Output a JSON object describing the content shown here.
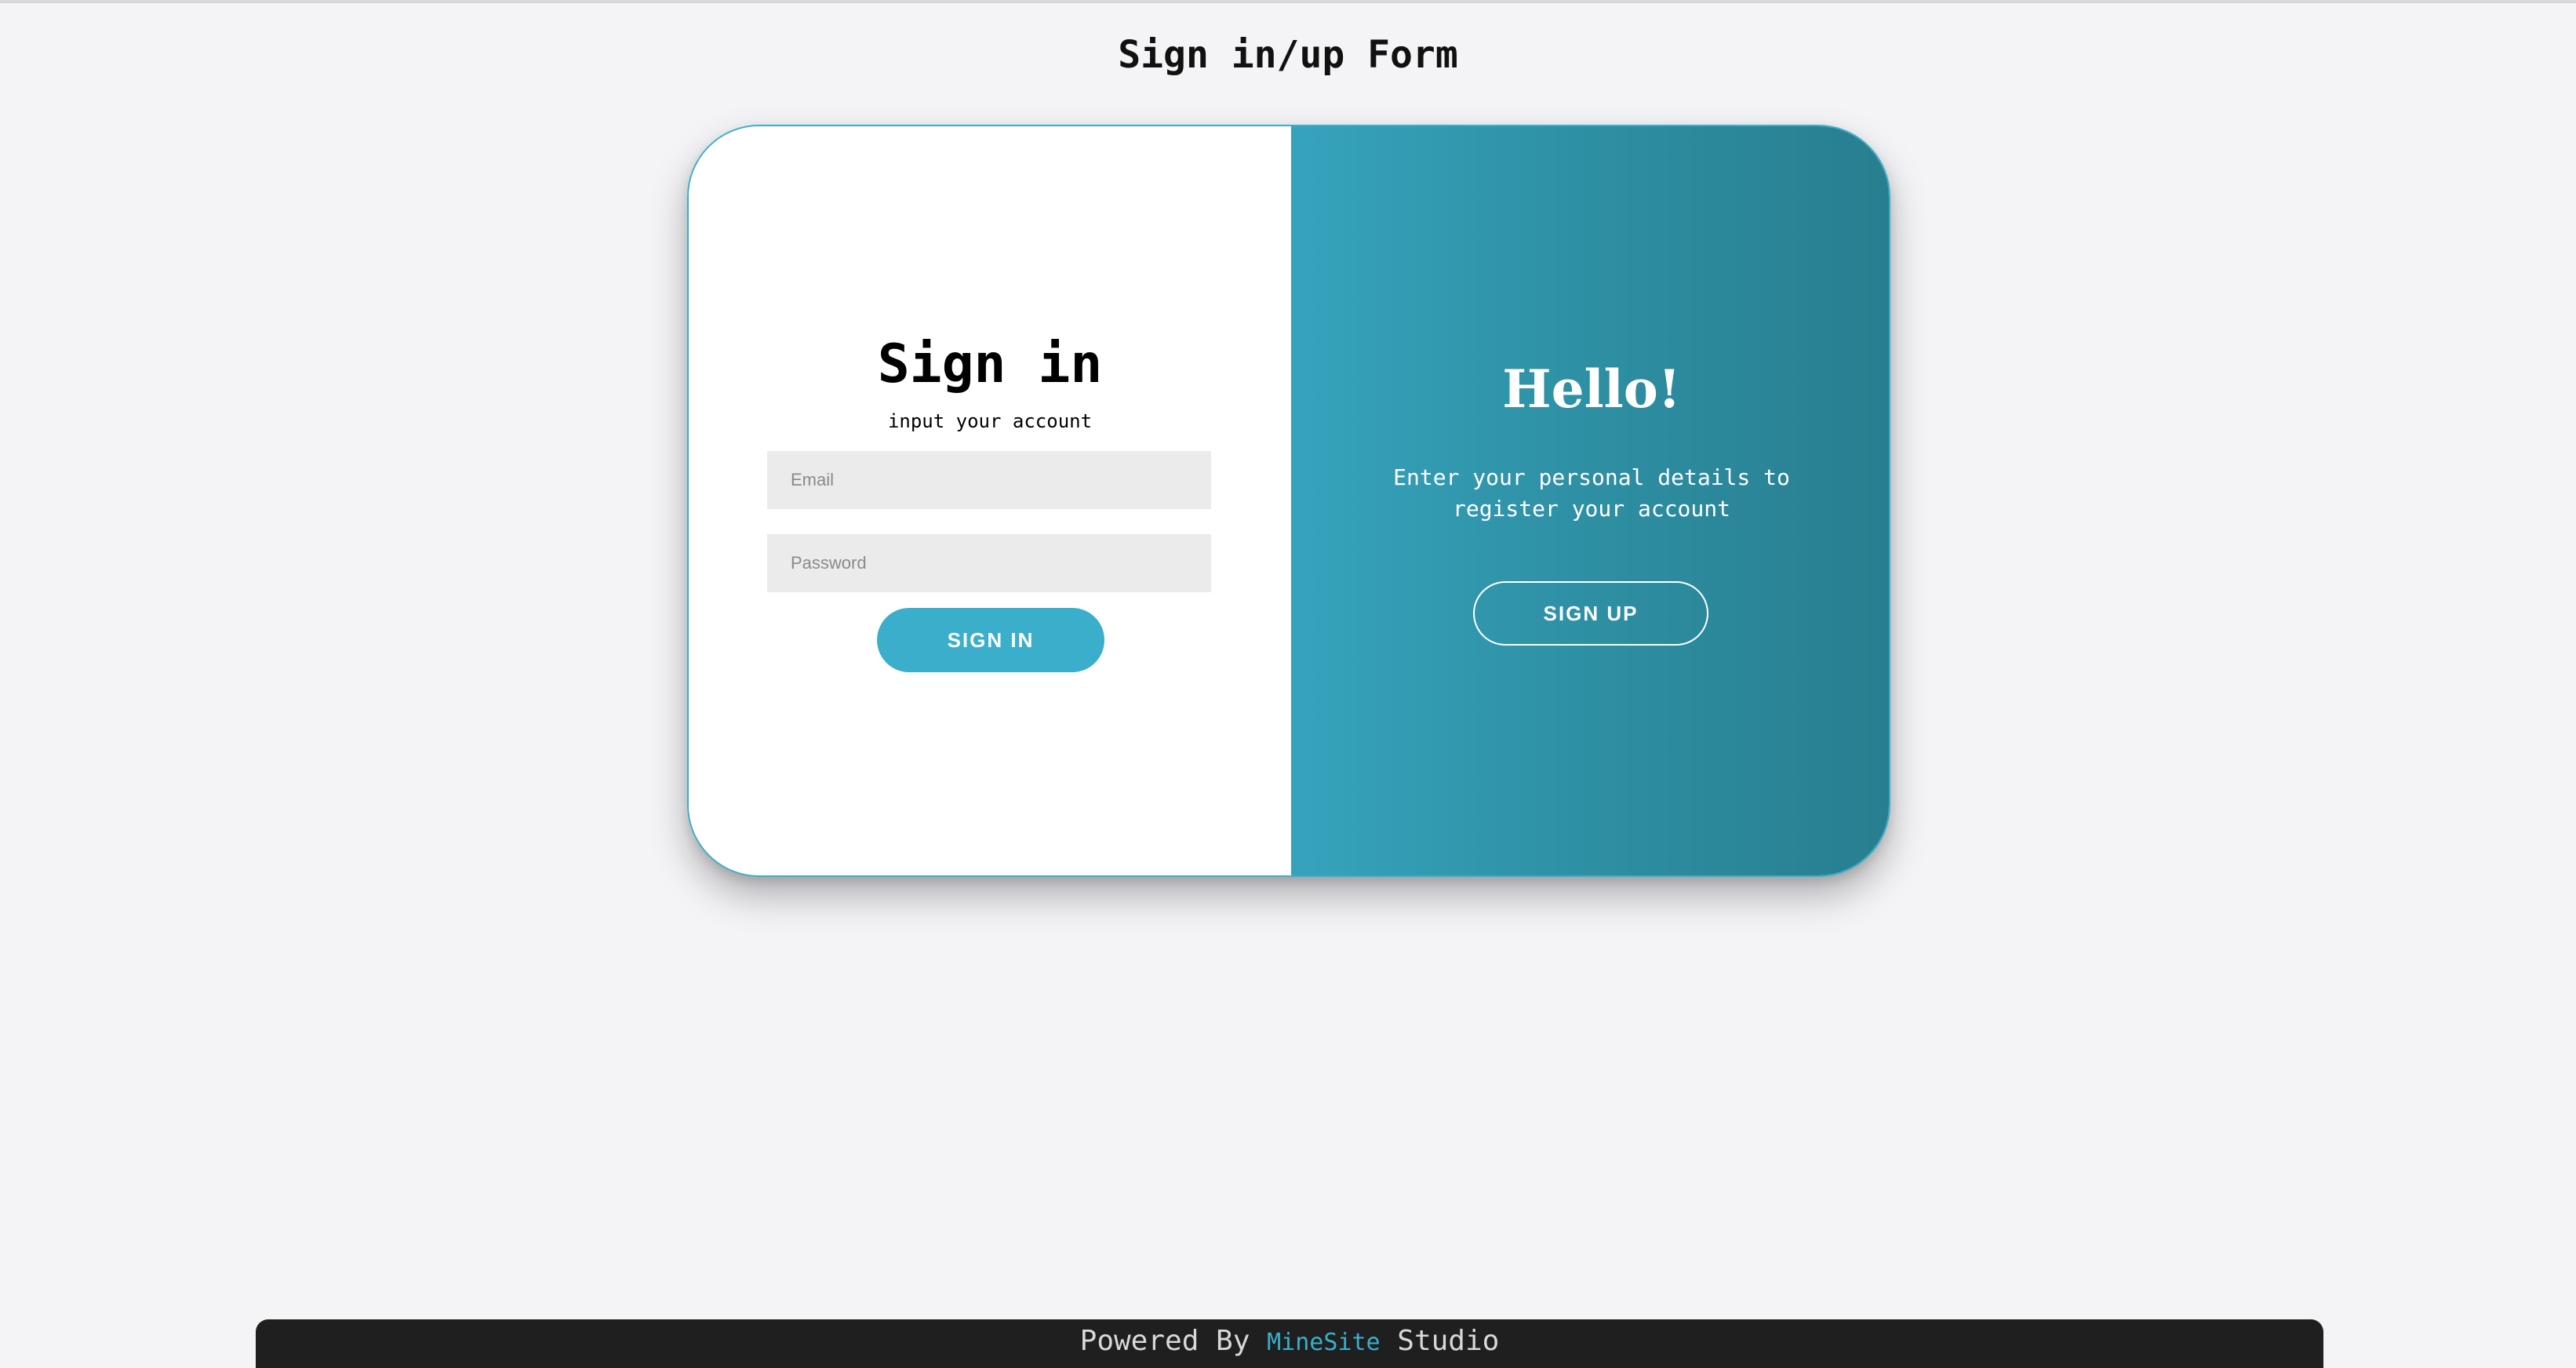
{
  "page": {
    "title": "Sign in/up Form"
  },
  "signin": {
    "title": "Sign in",
    "subtitle": "input your account",
    "email_placeholder": "Email",
    "password_placeholder": "Password",
    "button_label": "SIGN IN"
  },
  "signup_panel": {
    "title": "Hello!",
    "text": "Enter your personal details to register your account",
    "button_label": "SIGN UP"
  },
  "footer": {
    "prefix": "Powered By",
    "brand": "MineSite",
    "suffix": "Studio"
  },
  "colors": {
    "accent": "#3aaecb",
    "gradient_start": "#36a3bd",
    "gradient_end": "#277e8f",
    "footer_bg": "#1f1f1f",
    "page_bg": "#f4f4f6"
  }
}
